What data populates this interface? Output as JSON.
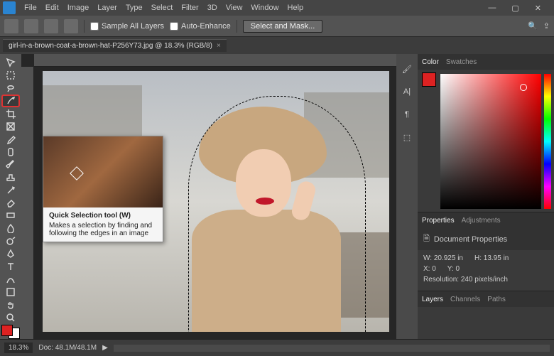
{
  "menu": {
    "items": [
      "File",
      "Edit",
      "Image",
      "Layer",
      "Type",
      "Select",
      "Filter",
      "3D",
      "View",
      "Window",
      "Help"
    ]
  },
  "window_ctrls": {
    "min": "—",
    "max": "▢",
    "close": "✕"
  },
  "options": {
    "sample_all": "Sample All Layers",
    "auto_enhance": "Auto-Enhance",
    "select_mask": "Select and Mask...",
    "search_icon": "search",
    "share_icon": "share"
  },
  "tab": {
    "title": "girl-in-a-brown-coat-a-brown-hat-P256Y73.jpg @ 18.3% (RGB/8)",
    "close": "×"
  },
  "tooltip": {
    "title": "Quick Selection tool (W)",
    "desc": "Makes a selection by finding and following the edges in an image"
  },
  "panel_tabs": {
    "color": "Color",
    "swatches": "Swatches"
  },
  "properties": {
    "tab_props": "Properties",
    "tab_adj": "Adjustments",
    "header": "Document Properties",
    "w_label": "W:",
    "w_val": "20.925 in",
    "h_label": "H:",
    "h_val": "13.95 in",
    "x_label": "X:",
    "x_val": "0",
    "y_label": "Y:",
    "y_val": "0",
    "res_label": "Resolution:",
    "res_val": "240 pixels/inch"
  },
  "layers_tabs": {
    "layers": "Layers",
    "channels": "Channels",
    "paths": "Paths"
  },
  "status": {
    "zoom": "18.3%",
    "doc": "Doc: 48.1M/48.1M",
    "arrow": "▶"
  }
}
